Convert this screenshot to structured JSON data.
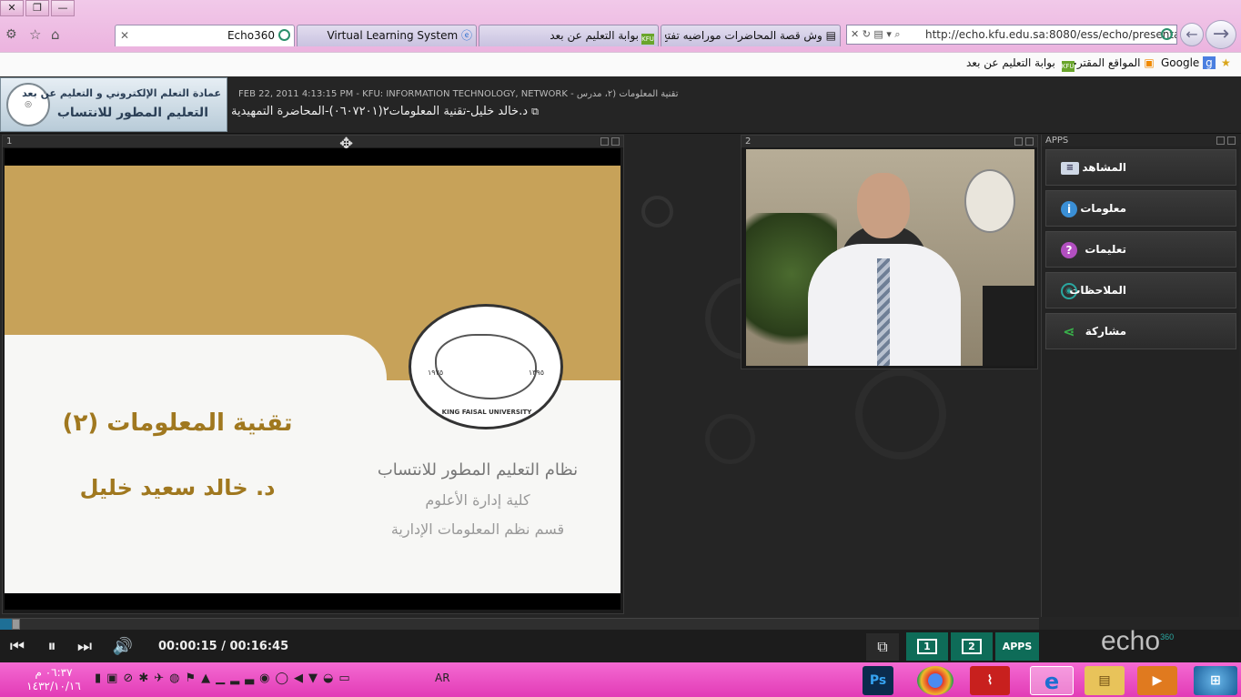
{
  "browser": {
    "tabs": [
      {
        "label": "Echo360",
        "active": true
      },
      {
        "label": "Virtual Learning System",
        "active": false
      },
      {
        "label": "بوابة التعليم عن بعد",
        "active": false
      },
      {
        "label": "وش قصة المحاضرات موراضيه تفتح؟...",
        "active": false
      }
    ],
    "address": "http://echo.kfu.edu.sa:8080/ess/echo/presentati",
    "favorites": [
      "Google",
      "المواقع المقترحة",
      "بوابة التعليم عن بعد"
    ],
    "favorites_icon_labels": [
      "g",
      "KFU"
    ]
  },
  "header": {
    "logo_line1": "عمادة التعلم الإلكتروني و التعليم عن بعد",
    "logo_line2": "التعليم المطور للانتساب",
    "meta": "FEB 22, 2011 4:13:15 PM - KFU: INFORMATION TECHNOLOGY, NETWORK - تقنية المعلومات (٢، مدرس",
    "title": "د.خالد خليل-تقنية المعلومات٢(٠٦٠٧٢٠١)-المحاضرة التمهيدية"
  },
  "panel1": {
    "number": "1",
    "slide": {
      "course": "تقنية المعلومات (٢)",
      "lecturer": "د. خالد سعيد خليل",
      "system": "نظام التعليم المطور للانتساب",
      "college": "كلية إدارة الأعلوم",
      "dept": "قسم نظم المعلومات الإدارية",
      "seal_text": "KING FAISAL UNIVERSITY",
      "seal_year_left": "١٩٧٥",
      "seal_year_right": "١٣٩٥"
    }
  },
  "panel2": {
    "number": "2"
  },
  "apps": {
    "title": "APPS",
    "items": [
      {
        "label": "المشاهد",
        "icon": "screens-icon",
        "color": "#cfd8e6"
      },
      {
        "label": "معلومات",
        "icon": "info-icon",
        "color": "#3a8fd6"
      },
      {
        "label": "تعليمات",
        "icon": "help-icon",
        "color": "#b24fc0"
      },
      {
        "label": "الملاحظات",
        "icon": "notes-icon",
        "color": "#2aa7a0"
      },
      {
        "label": "مشاركة",
        "icon": "share-icon",
        "color": "#39b04a"
      }
    ]
  },
  "player": {
    "time": "00:00:15 / 00:16:45",
    "progress": 0.015,
    "btn1": "1",
    "btn2": "2",
    "apps_btn": "APPS",
    "brand": "echo",
    "brand_sup": "360"
  },
  "taskbar": {
    "time": "٠٦:٣٧ م",
    "date": "١٤٣٢/١٠/١٦",
    "lang": "AR",
    "apps": [
      {
        "name": "windows-start-icon",
        "label": ""
      },
      {
        "name": "media-player-icon",
        "label": ""
      },
      {
        "name": "explorer-icon",
        "label": ""
      },
      {
        "name": "ie-icon",
        "label": "e"
      },
      {
        "name": "acrobat-icon",
        "label": ""
      },
      {
        "name": "chrome-icon",
        "label": ""
      },
      {
        "name": "photoshop-icon",
        "label": "Ps"
      }
    ]
  }
}
